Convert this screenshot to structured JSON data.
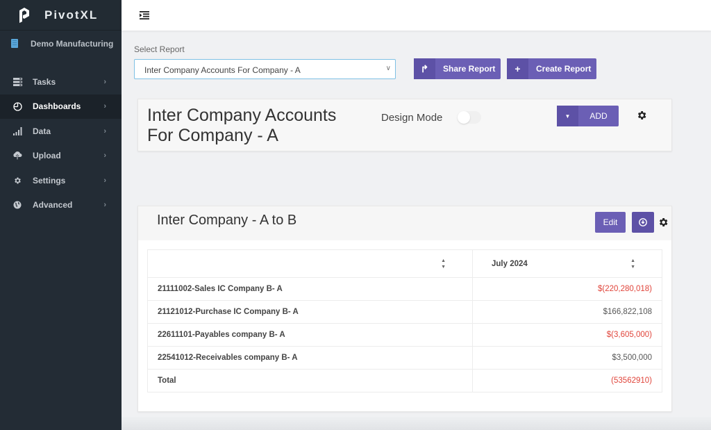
{
  "app": {
    "brand": "PivotXL",
    "organization": "Demo Manufacturing"
  },
  "sidebar": {
    "items": [
      {
        "label": "Tasks",
        "icon": "tasks-icon",
        "active": false
      },
      {
        "label": "Dashboards",
        "icon": "dashboard-icon",
        "active": true
      },
      {
        "label": "Data",
        "icon": "bar-chart-icon",
        "active": false
      },
      {
        "label": "Upload",
        "icon": "cloud-upload-icon",
        "active": false
      },
      {
        "label": "Settings",
        "icon": "gear-icon",
        "active": false
      },
      {
        "label": "Advanced",
        "icon": "globe-icon",
        "active": false
      }
    ]
  },
  "toolbar": {
    "select_label": "Select Report",
    "selected_report": "Inter Company Accounts For Company - A",
    "share_label": "Share Report",
    "create_label": "Create Report"
  },
  "report": {
    "title": "Inter Company Accounts For Company - A",
    "design_mode_label": "Design Mode",
    "design_mode_on": false,
    "add_label": "ADD"
  },
  "widget": {
    "title": "Inter Company - A to B",
    "edit_label": "Edit",
    "columns": [
      "",
      "July 2024"
    ],
    "rows": [
      {
        "label": "21111002-Sales IC Company B- A",
        "value": "$(220,280,018)",
        "negative": true
      },
      {
        "label": "21121012-Purchase IC Company B- A",
        "value": "$166,822,108",
        "negative": false
      },
      {
        "label": "22611101-Payables company B- A",
        "value": "$(3,605,000)",
        "negative": true
      },
      {
        "label": "22541012-Receivables company B- A",
        "value": "$3,500,000",
        "negative": false
      },
      {
        "label": "Total",
        "value": "(53562910)",
        "negative": true
      }
    ]
  },
  "colors": {
    "sidebar_bg": "#232c35",
    "accent_purple": "#6b5fb5",
    "negative_red": "#e0443a"
  }
}
